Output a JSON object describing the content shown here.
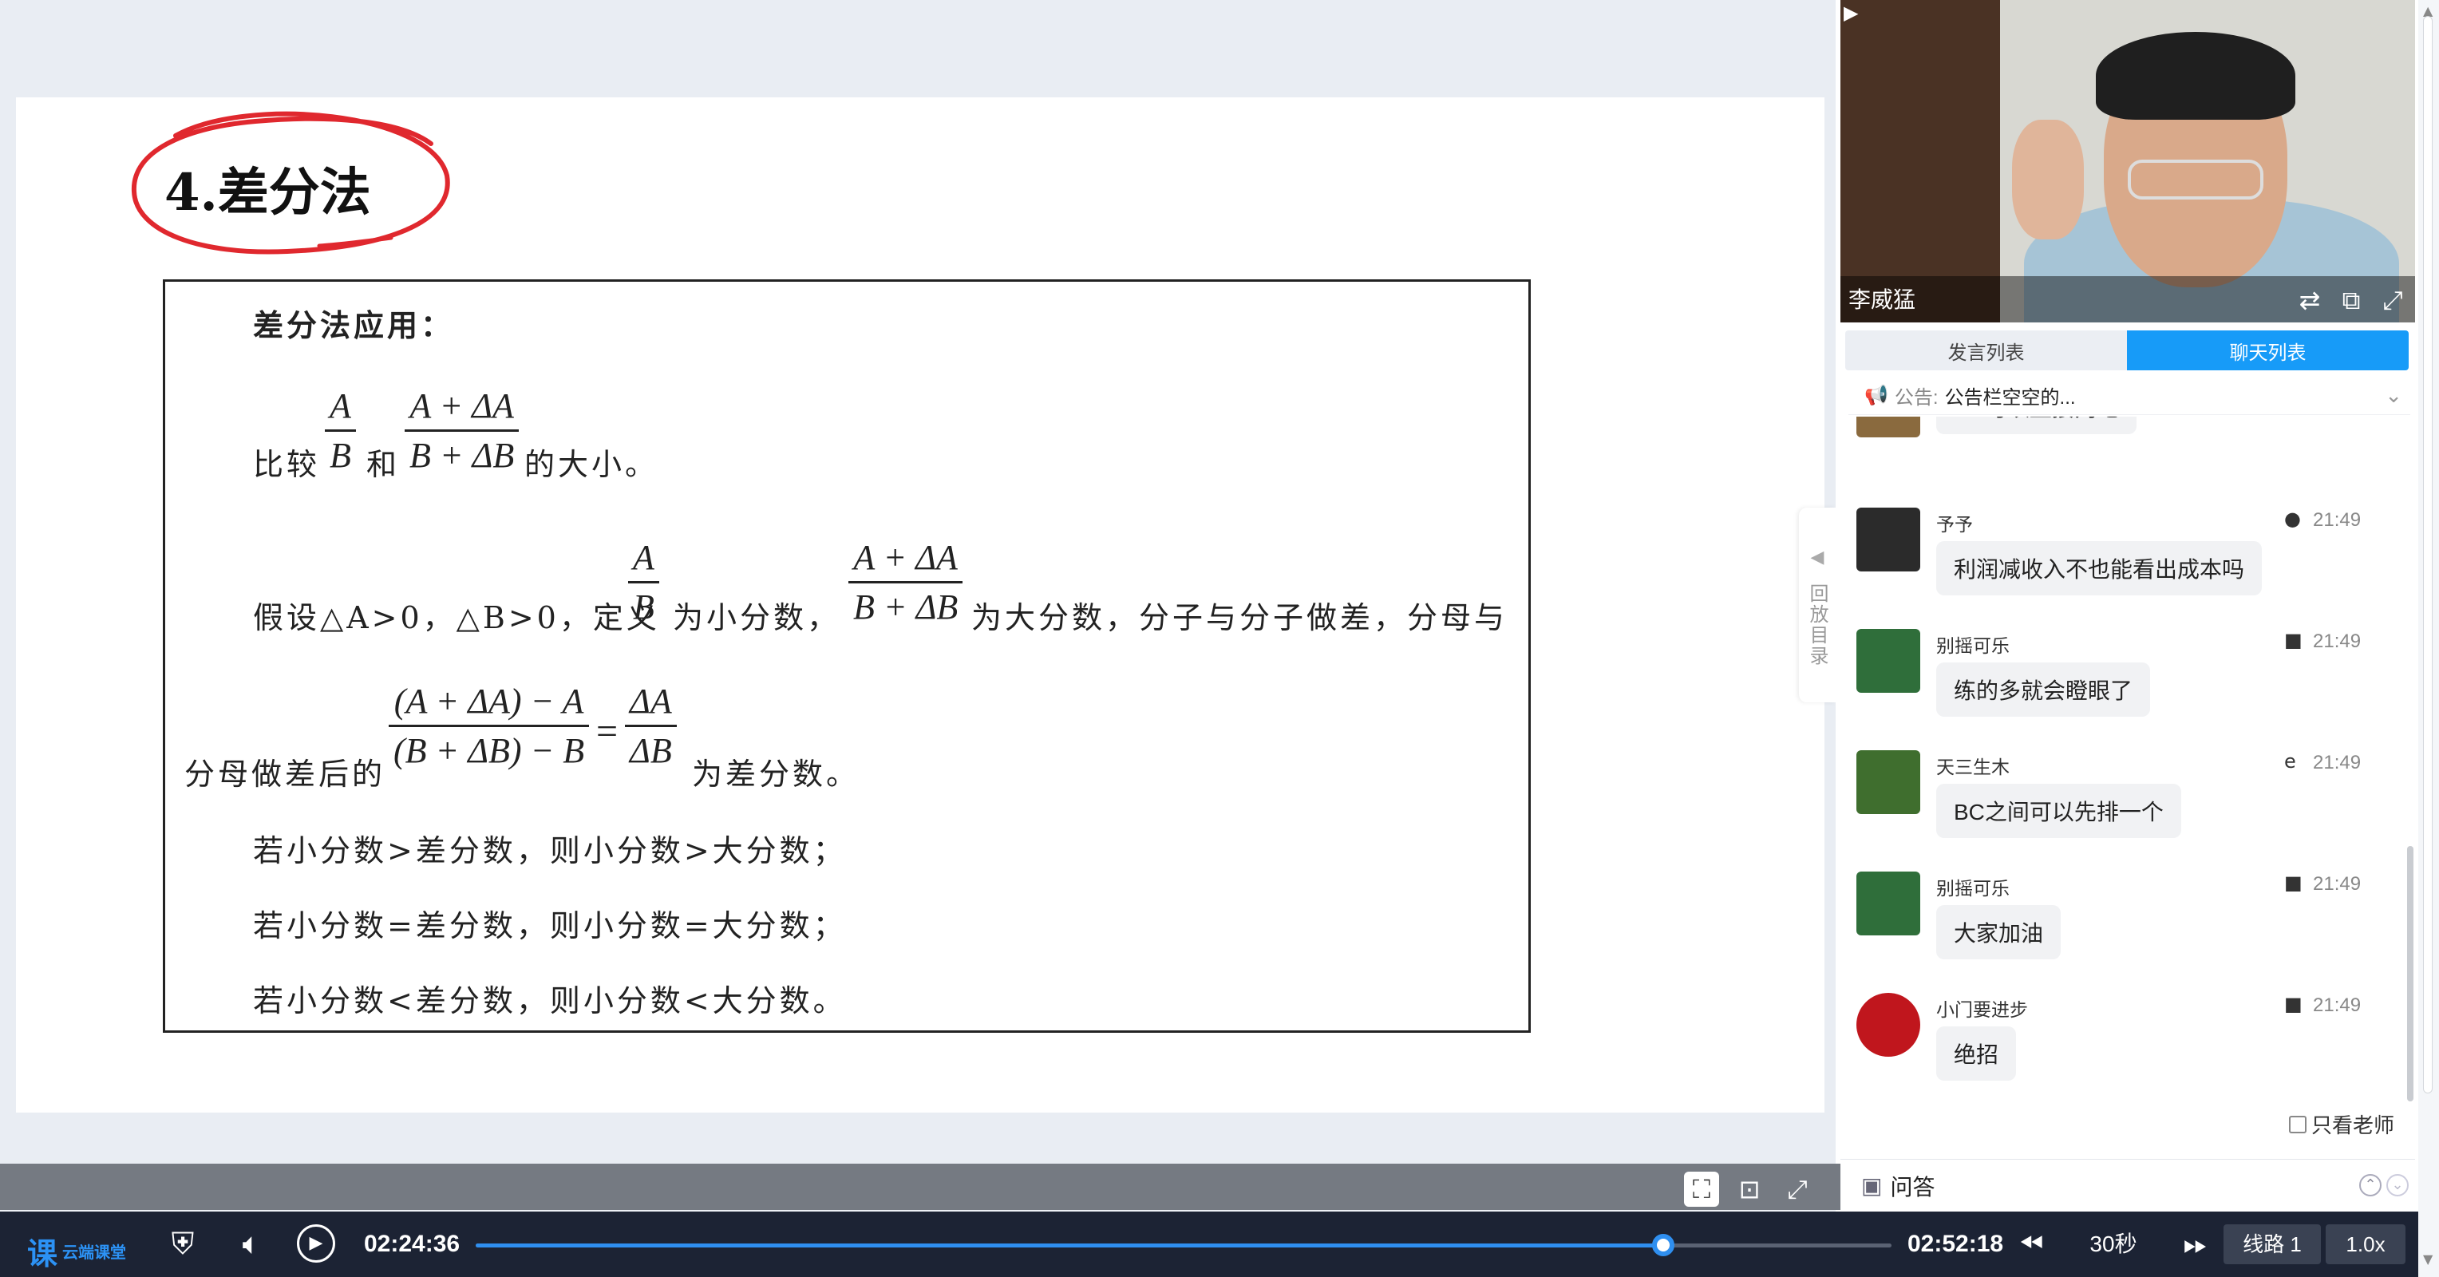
{
  "slide": {
    "heading": "4.差分法",
    "box_title": "差分法应用：",
    "compare_prefix": "比较",
    "compare_mid": "和",
    "compare_suffix": "的大小。",
    "assume_text": "假设△A>0，△B>0，定义",
    "small_label": "为小分数，",
    "big_label": "为大分数，分子与分子做差，分母与",
    "diff_prefix": "分母做差后的",
    "diff_suffix": "为差分数。",
    "rule1": "若小分数>差分数，则小分数>大分数；",
    "rule2": "若小分数=差分数，则小分数=大分数；",
    "rule3": "若小分数<差分数，则小分数<大分数。",
    "frac_a_num": "A",
    "frac_a_den": "B",
    "frac_big_num": "A + ΔA",
    "frac_big_den": "B + ΔB",
    "frac_diff_num": "(A + ΔA) − A",
    "frac_diff_den": "(B + ΔB) − B",
    "equals": "=",
    "frac_delta_num": "ΔA",
    "frac_delta_den": "ΔB"
  },
  "replay_tab": {
    "label": "回放目录"
  },
  "video": {
    "teacher_name": "李威猛"
  },
  "tabs": {
    "speakers": "发言列表",
    "chat": "聊天列表"
  },
  "notice": {
    "label": "公告:",
    "text": "公告栏空空的..."
  },
  "chat": [
    {
      "user": "",
      "time": "",
      "device": "",
      "text": "BC可以直接判吧",
      "avatar_color": "#8a6a3e"
    },
    {
      "user": "予予",
      "time": "21:49",
      "device": "apple-icon",
      "text": "利润减收入不也能看出成本吗",
      "avatar_color": "#2b2b2b"
    },
    {
      "user": "别摇可乐",
      "time": "21:49",
      "device": "android-icon",
      "text": "练的多就会瞪眼了",
      "avatar_color": "#2f6e3a"
    },
    {
      "user": "天三生木",
      "time": "21:49",
      "device": "edge-icon",
      "text": "BC之间可以先排一个",
      "avatar_color": "#3f6e2e"
    },
    {
      "user": "别摇可乐",
      "time": "21:49",
      "device": "android-icon",
      "text": "大家加油",
      "avatar_color": "#2f6e3a"
    },
    {
      "user": "小门要进步",
      "time": "21:49",
      "device": "android-icon",
      "text": "绝招",
      "avatar_color": "#c0161d"
    }
  ],
  "only_teacher": "只看老师",
  "qa": {
    "label": "问答"
  },
  "player": {
    "logo_text": "云端课堂",
    "current_time": "02:24:36",
    "total_time": "02:52:18",
    "progress_fraction": 0.8386,
    "skip_amount": "30秒",
    "line": "线路 1",
    "speed": "1.0x"
  },
  "colors": {
    "accent": "#179bf8",
    "player_bg": "#1c2334",
    "progress": "#2f8ff0",
    "annotation": "#e0282e"
  }
}
